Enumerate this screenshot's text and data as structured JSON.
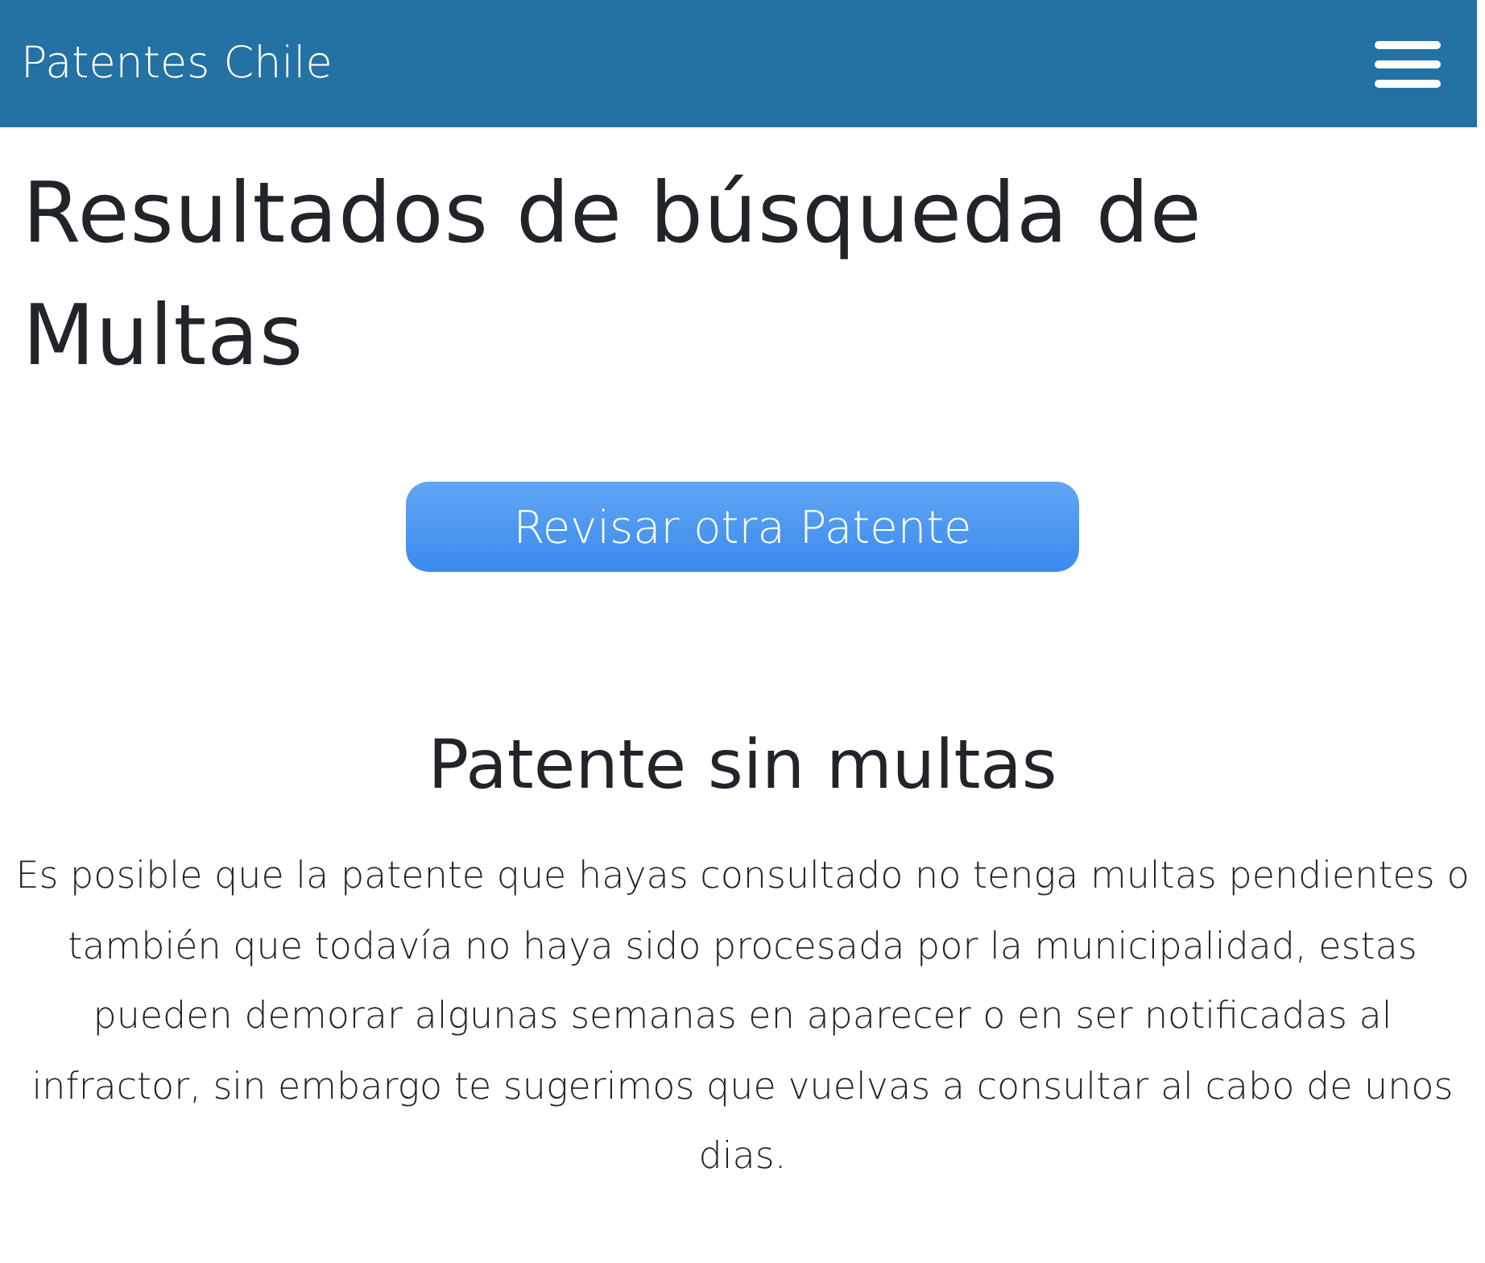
{
  "navbar": {
    "brand": "Patentes Chile"
  },
  "page": {
    "title": "Resultados de búsqueda de Multas",
    "button": "Revisar otra Patente"
  },
  "result": {
    "heading": "Patente sin multas",
    "text": "Es posible que la patente que hayas consultado no tenga multas pendientes o también que todavía no haya sido procesada por la municipalidad, estas pueden demorar algunas semanas en aparecer o en ser notificadas al infractor, sin embargo te sugerimos que vuelvas a consultar al cabo de unos dias."
  }
}
